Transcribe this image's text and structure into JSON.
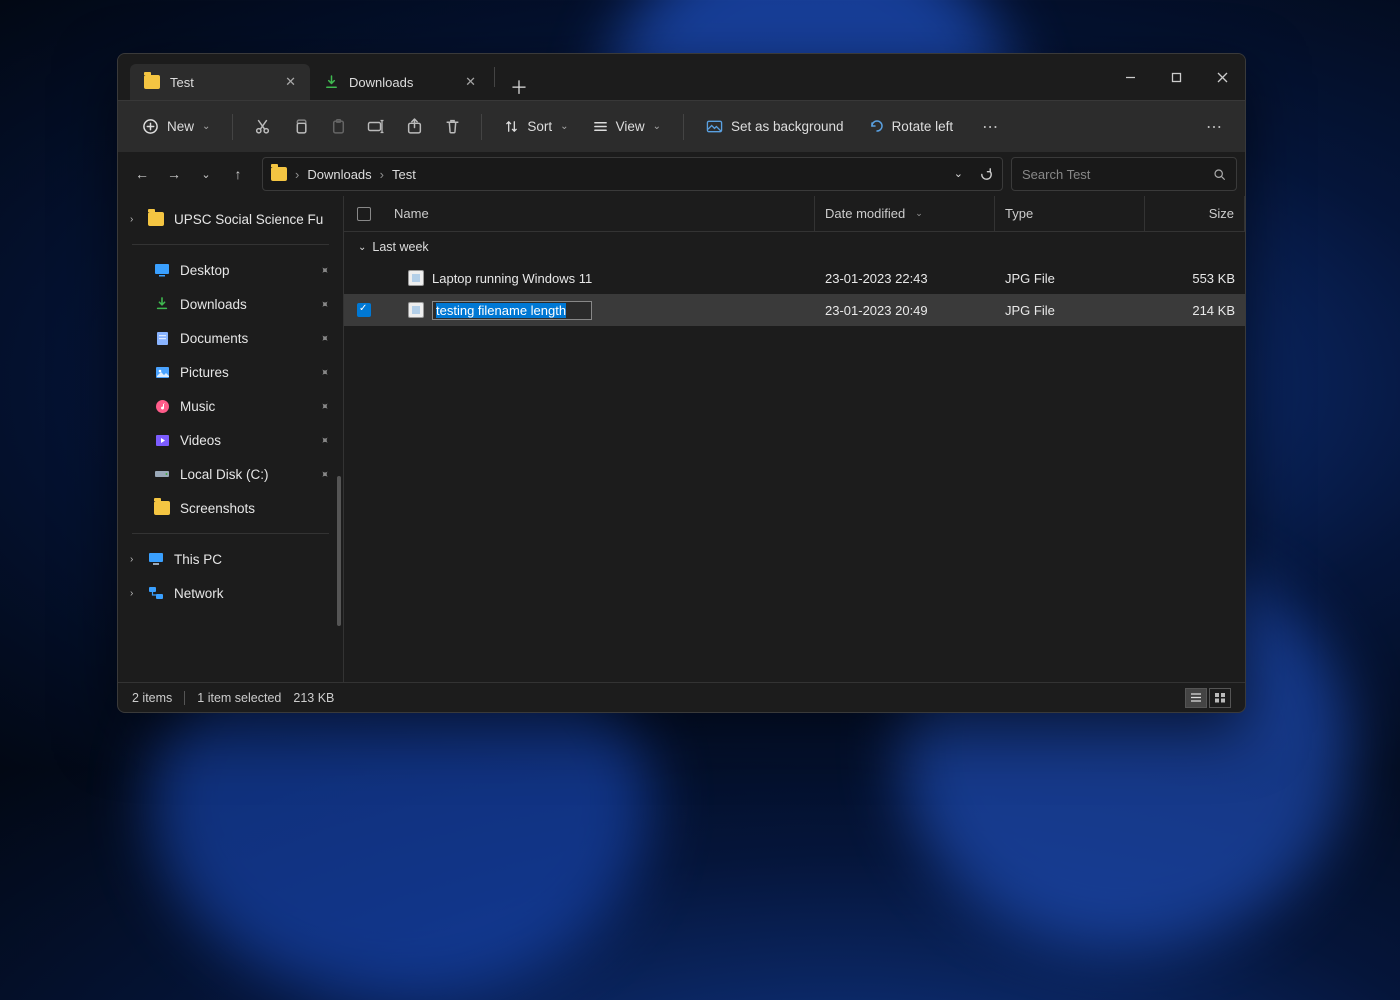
{
  "tabs": [
    {
      "label": "Test",
      "icon": "folder",
      "active": true
    },
    {
      "label": "Downloads",
      "icon": "download",
      "active": false
    }
  ],
  "toolbar": {
    "new_label": "New",
    "sort_label": "Sort",
    "view_label": "View",
    "set_bg_label": "Set as background",
    "rotate_left_label": "Rotate left"
  },
  "addressbar": {
    "crumbs": [
      "Downloads",
      "Test"
    ]
  },
  "search": {
    "placeholder": "Search Test"
  },
  "sidebar": {
    "top_item": "UPSC Social Science Fu",
    "quick": [
      {
        "label": "Desktop",
        "color": "#3aa0ff",
        "pinned": true
      },
      {
        "label": "Downloads",
        "color": "#3fb950",
        "pinned": true
      },
      {
        "label": "Documents",
        "color": "#89b4ff",
        "pinned": true
      },
      {
        "label": "Pictures",
        "color": "#4aa3ff",
        "pinned": true
      },
      {
        "label": "Music",
        "color": "#ff5c8a",
        "pinned": true
      },
      {
        "label": "Videos",
        "color": "#7c5cff",
        "pinned": true
      },
      {
        "label": "Local Disk (C:)",
        "color": "#9aa8b8",
        "pinned": true
      },
      {
        "label": "Screenshots",
        "color": "#f4c542",
        "pinned": false
      }
    ],
    "bottom": [
      {
        "label": "This PC",
        "icon": "pc"
      },
      {
        "label": "Network",
        "icon": "network"
      }
    ]
  },
  "columns": {
    "name": "Name",
    "date": "Date modified",
    "type": "Type",
    "size": "Size"
  },
  "group_label": "Last week",
  "files": [
    {
      "name": "Laptop running Windows 11",
      "date": "23-01-2023 22:43",
      "type": "JPG File",
      "size": "553 KB",
      "selected": false,
      "renaming": false
    },
    {
      "name": "testing filename length",
      "date": "23-01-2023 20:49",
      "type": "JPG File",
      "size": "214 KB",
      "selected": true,
      "renaming": true
    }
  ],
  "status": {
    "items": "2 items",
    "selected": "1 item selected",
    "size": "213 KB"
  }
}
